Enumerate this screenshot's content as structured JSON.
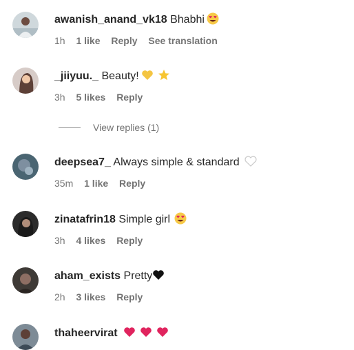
{
  "comments": [
    {
      "username": "awanish_anand_vk18",
      "text": "Bhabhi",
      "emoji": "heart-eyes",
      "time": "1h",
      "likes": "1 like",
      "reply": "Reply",
      "translate": "See translation"
    },
    {
      "username": "_jiiyuu._",
      "text": "Beauty!",
      "emoji": "yellow-heart, star",
      "time": "3h",
      "likes": "5 likes",
      "reply": "Reply",
      "view_replies": "View replies (1)"
    },
    {
      "username": "deepsea7_",
      "text": "Always simple & standard",
      "emoji": "white-heart",
      "time": "35m",
      "likes": "1 like",
      "reply": "Reply"
    },
    {
      "username": "zinatafrin18",
      "text": "Simple girl",
      "emoji": "heart-eyes",
      "time": "3h",
      "likes": "4 likes",
      "reply": "Reply"
    },
    {
      "username": "aham_exists",
      "text": "Pretty",
      "emoji": "black-heart",
      "time": "2h",
      "likes": "3 likes",
      "reply": "Reply"
    },
    {
      "username": "thaheervirat",
      "text": "",
      "emoji": "red-heart x3"
    }
  ],
  "colors": {
    "username": "#262626",
    "meta": "#737373",
    "heart_red": "#e0245e",
    "heart_yellow": "#f4c542",
    "heart_eyes_face": "#f7c948"
  }
}
